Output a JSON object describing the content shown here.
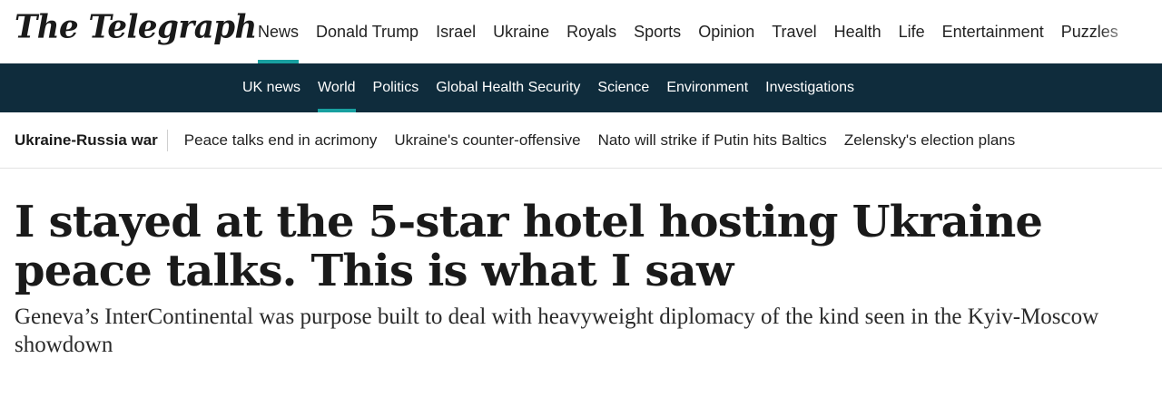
{
  "brand": {
    "logo_text": "The Telegraph"
  },
  "main_nav": [
    {
      "label": "News",
      "active": true
    },
    {
      "label": "Donald Trump"
    },
    {
      "label": "Israel"
    },
    {
      "label": "Ukraine"
    },
    {
      "label": "Royals"
    },
    {
      "label": "Sports"
    },
    {
      "label": "Opinion"
    },
    {
      "label": "Travel"
    },
    {
      "label": "Health"
    },
    {
      "label": "Life"
    },
    {
      "label": "Entertainment"
    },
    {
      "label": "Puzzles"
    }
  ],
  "sub_nav": [
    {
      "label": "UK news"
    },
    {
      "label": "World",
      "active": true
    },
    {
      "label": "Politics"
    },
    {
      "label": "Global Health Security"
    },
    {
      "label": "Science"
    },
    {
      "label": "Environment"
    },
    {
      "label": "Investigations"
    }
  ],
  "topics": {
    "section": "Ukraine-Russia war",
    "links": [
      "Peace talks end in acrimony",
      "Ukraine's counter-offensive",
      "Nato will strike if Putin hits Baltics",
      "Zelensky's election plans"
    ]
  },
  "article": {
    "headline": "I stayed at the 5-star hotel hosting Ukraine peace talks. This is what I saw",
    "standfirst": "Geneva’s InterContinental was purpose built to deal with heavyweight diplomacy of the kind seen in the Kyiv-Moscow showdown"
  },
  "colors": {
    "accent": "#18a0a0",
    "subnav_bg": "#0f2c3c"
  }
}
